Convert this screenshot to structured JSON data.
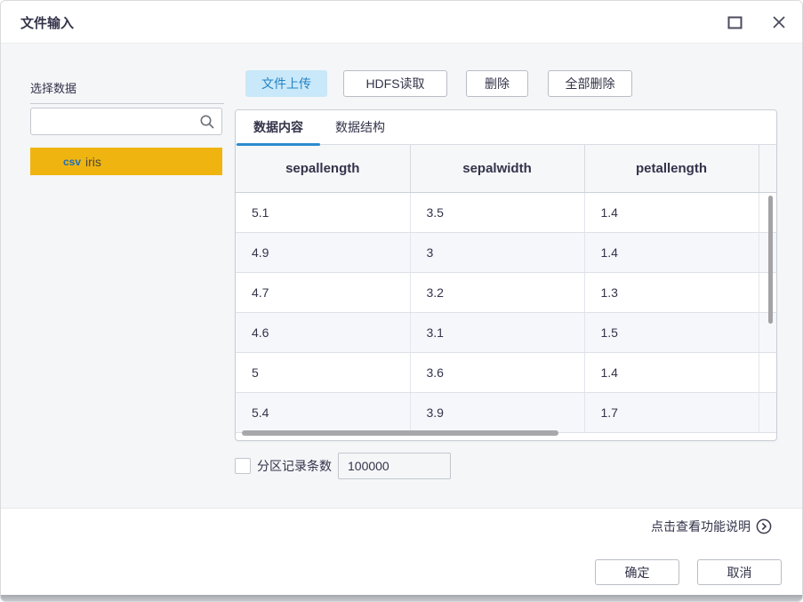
{
  "window": {
    "title": "文件输入"
  },
  "left_panel": {
    "label": "选择数据",
    "search": {
      "value": "",
      "placeholder": ""
    },
    "items": [
      {
        "type": "csv",
        "name": "iris",
        "selected": true
      }
    ]
  },
  "toolbar": {
    "buttons": [
      {
        "label": "文件上传",
        "active": true
      },
      {
        "label": "HDFS读取",
        "active": false
      },
      {
        "label": "删除",
        "active": false
      },
      {
        "label": "全部删除",
        "active": false
      }
    ]
  },
  "tabs": [
    {
      "label": "数据内容",
      "active": true
    },
    {
      "label": "数据结构",
      "active": false
    }
  ],
  "table": {
    "columns": [
      "sepallength",
      "sepalwidth",
      "petallength"
    ],
    "rows": [
      [
        "5.1",
        "3.5",
        "1.4"
      ],
      [
        "4.9",
        "3",
        "1.4"
      ],
      [
        "4.7",
        "3.2",
        "1.3"
      ],
      [
        "4.6",
        "3.1",
        "1.5"
      ],
      [
        "5",
        "3.6",
        "1.4"
      ],
      [
        "5.4",
        "3.9",
        "1.7"
      ]
    ]
  },
  "partition": {
    "label": "分区记录条数",
    "value": "100000",
    "checked": false
  },
  "footer": {
    "help_link": "点击查看功能说明",
    "ok_label": "确定",
    "cancel_label": "取消"
  },
  "colors": {
    "accent_blue": "#2b8bd0",
    "upload_btn_bg": "#c9e8f9",
    "upload_btn_text": "#2384c6",
    "selected_item_yellow": "#f0b410",
    "csv_badge_blue": "#1c6fb8",
    "content_bg": "#f4f6f8",
    "alt_row_bg": "#f5f7fb",
    "text_dark": "#33334a"
  }
}
